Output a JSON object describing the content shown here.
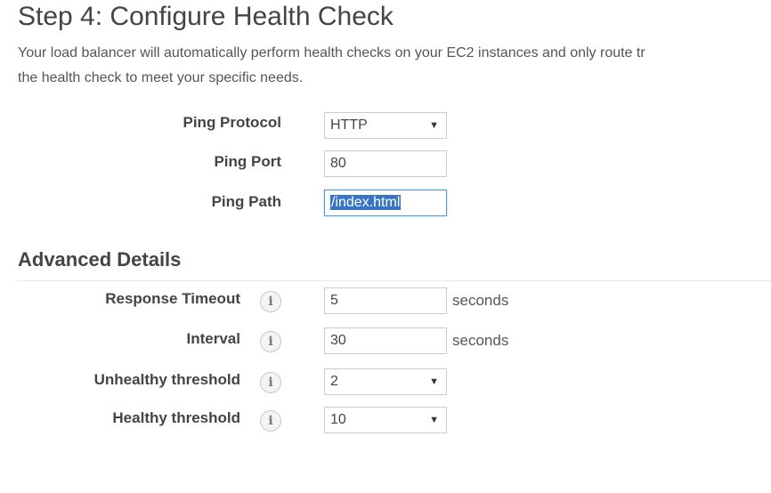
{
  "page": {
    "title": "Step 4: Configure Health Check",
    "description_line1": "Your load balancer will automatically perform health checks on your EC2 instances and only route tr",
    "description_line2": "the health check to meet your specific needs."
  },
  "health_check": {
    "ping_protocol": {
      "label": "Ping Protocol",
      "value": "HTTP"
    },
    "ping_port": {
      "label": "Ping Port",
      "value": "80"
    },
    "ping_path": {
      "label": "Ping Path",
      "value_prefix": "/",
      "value_selected": "index.html"
    }
  },
  "advanced": {
    "title": "Advanced Details",
    "response_timeout": {
      "label": "Response Timeout",
      "value": "5",
      "unit": "seconds"
    },
    "interval": {
      "label": "Interval",
      "value": "30",
      "unit": "seconds"
    },
    "unhealthy_threshold": {
      "label": "Unhealthy threshold",
      "value": "2"
    },
    "healthy_threshold": {
      "label": "Healthy threshold",
      "value": "10"
    }
  },
  "icons": {
    "info": "i",
    "dropdown": "▼"
  },
  "colors": {
    "selection": "#3a75c4",
    "focus_border": "#5b9bd5"
  }
}
